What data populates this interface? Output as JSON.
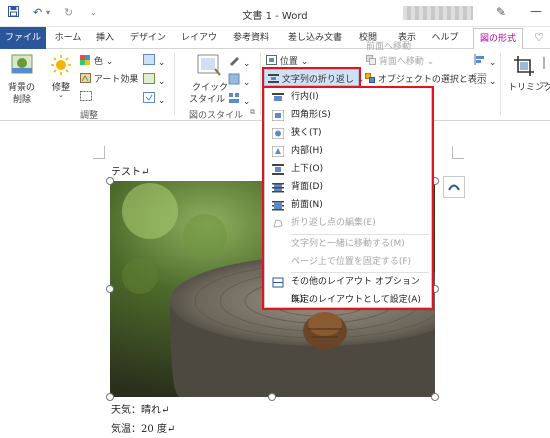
{
  "titlebar": {
    "doc_title": "文書 1  -  Word"
  },
  "tabs": [
    {
      "label": "ファイル"
    },
    {
      "label": "ホーム"
    },
    {
      "label": "挿入"
    },
    {
      "label": "デザイン"
    },
    {
      "label": "レイアウト"
    },
    {
      "label": "参考資料"
    },
    {
      "label": "差し込み文書"
    },
    {
      "label": "校閲"
    },
    {
      "label": "表示"
    },
    {
      "label": "ヘルプ"
    },
    {
      "label": "図の形式"
    }
  ],
  "ribbon": {
    "remove_bg": {
      "line1": "背景の",
      "line2": "削除"
    },
    "corrections": "修整",
    "color": "色",
    "artistic": "アート効果",
    "adjust_group": "調整",
    "quick_styles": {
      "line1": "クイック",
      "line2": "スタイル"
    },
    "styles_group": "図のスタイル",
    "position": "位置",
    "wrap_text": "文字列の折り返し",
    "bring_forward": "前面へ移動",
    "send_backward": "背面へ移動",
    "selection_pane": "オブジェクトの選択と表示",
    "crop": "トリミング"
  },
  "wrap_menu": {
    "items": [
      {
        "label": "行内(I)",
        "enabled": true
      },
      {
        "label": "四角形(S)",
        "enabled": true
      },
      {
        "label": "狭く(T)",
        "enabled": true
      },
      {
        "label": "内部(H)",
        "enabled": true
      },
      {
        "label": "上下(O)",
        "enabled": true
      },
      {
        "label": "背面(D)",
        "enabled": true
      },
      {
        "label": "前面(N)",
        "enabled": true
      },
      {
        "label": "折り返し点の編集(E)",
        "enabled": false
      },
      {
        "label": "文字列と一緒に移動する(M)",
        "enabled": false
      },
      {
        "label": "ページ上で位置を固定する(F)",
        "enabled": false
      },
      {
        "label": "その他のレイアウト オプション(L)...",
        "enabled": true
      },
      {
        "label": "既定のレイアウトとして設定(A)",
        "enabled": true
      }
    ]
  },
  "document": {
    "line1": "テスト↵",
    "line2": "天気：晴れ↵",
    "line3": "気温：20 度↵"
  },
  "colors": {
    "file_tab": "#2b579a",
    "active_tab_text": "#b4009e",
    "highlight": "#e2141f"
  }
}
